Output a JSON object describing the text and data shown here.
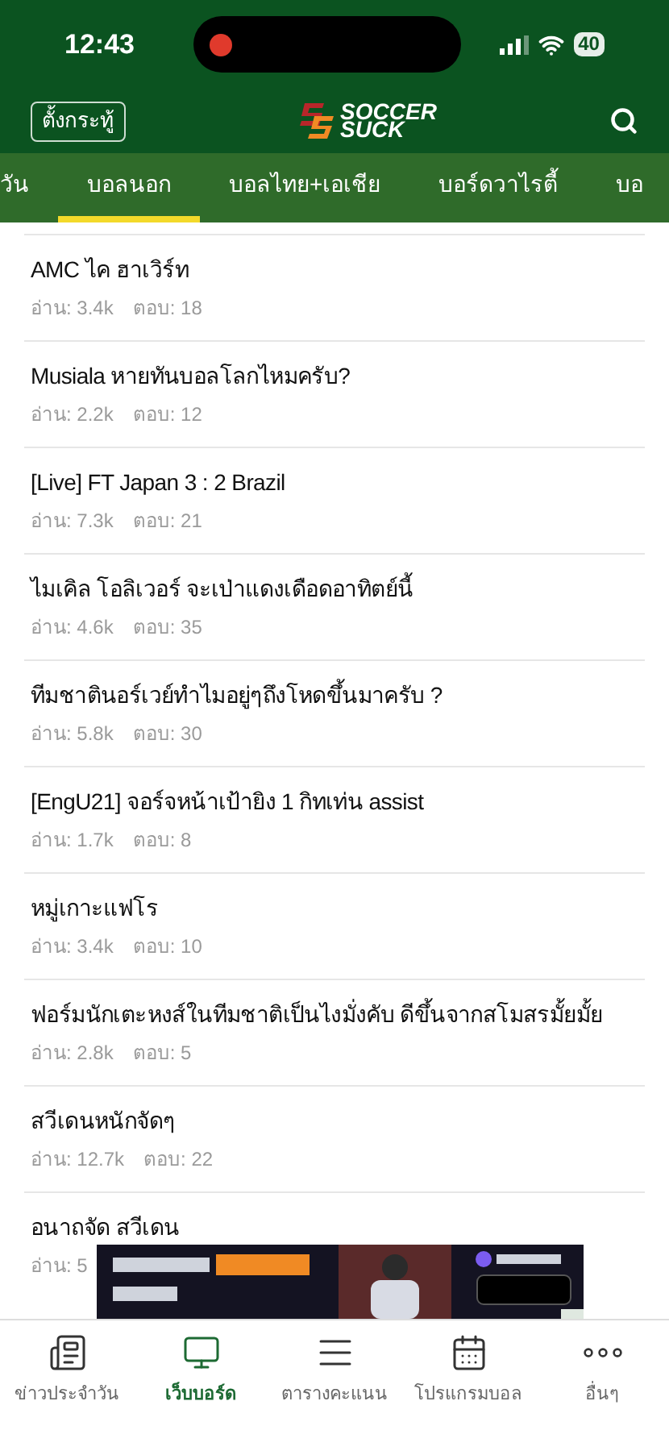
{
  "status_bar": {
    "time": "12:43",
    "battery": "40",
    "recording": true
  },
  "header": {
    "left_button": "ตั้งกระทู้",
    "logo_top": "SOCCER",
    "logo_bottom": "SUCK"
  },
  "tabs": [
    {
      "label": "วัน",
      "selected": false
    },
    {
      "label": "บอลนอก",
      "selected": true
    },
    {
      "label": "บอลไทย+เอเชีย",
      "selected": false
    },
    {
      "label": "บอร์ดวาไรตี้",
      "selected": false
    },
    {
      "label": "บอ",
      "selected": false
    }
  ],
  "topics": [
    {
      "title": "AMC ไค ฮาเวิร์ท",
      "meta": [
        "อ่าน: 3.4k",
        "ตอบ: 18"
      ]
    },
    {
      "title": "Musiala หายทันบอลโลกไหมครับ?",
      "meta": [
        "อ่าน: 2.2k",
        "ตอบ: 12"
      ]
    },
    {
      "title": "[Live] FT Japan 3 : 2 Brazil",
      "meta": [
        "อ่าน: 7.3k",
        "ตอบ: 21"
      ]
    },
    {
      "title": "ไมเคิล โอลิเวอร์ จะเป่าแดงเดือดอาทิตย์นี้",
      "meta": [
        "อ่าน: 4.6k",
        "ตอบ: 35"
      ]
    },
    {
      "title": "ทีมชาตินอร์เวย์ทำไมอยู่ๆถึงโหดขึ้นมาครับ ?",
      "meta": [
        "อ่าน: 5.8k",
        "ตอบ: 30"
      ]
    },
    {
      "title": "[EngU21] จอร์จหน้าเป้ายิง 1 กิทเท่น assist",
      "meta": [
        "อ่าน: 1.7k",
        "ตอบ: 8"
      ]
    },
    {
      "title": "หมู่เกาะแฟโร",
      "meta": [
        "อ่าน: 3.4k",
        "ตอบ: 10"
      ]
    },
    {
      "title": "ฟอร์มนักเตะหงส์ในทีมชาติเป็นไงมั่งคับ ดีขึ้นจากสโมสรมั้ยมั้ย",
      "meta": [
        "อ่าน: 2.8k",
        "ตอบ: 5"
      ]
    },
    {
      "title": "สวีเดนหนักจัดๆ",
      "meta": [
        "อ่าน: 12.7k",
        "ตอบ: 22"
      ]
    },
    {
      "title": "อนาถจัด สวีเดน",
      "meta": [
        "อ่าน: 5"
      ]
    }
  ],
  "bottom_nav": [
    {
      "label": "ข่าวประจำวัน",
      "selected": false
    },
    {
      "label": "เว็บบอร์ด",
      "selected": true
    },
    {
      "label": "ตารางคะแนน",
      "selected": false
    },
    {
      "label": "โปรแกรมบอล",
      "selected": false
    },
    {
      "label": "อื่นๆ",
      "selected": false
    }
  ]
}
